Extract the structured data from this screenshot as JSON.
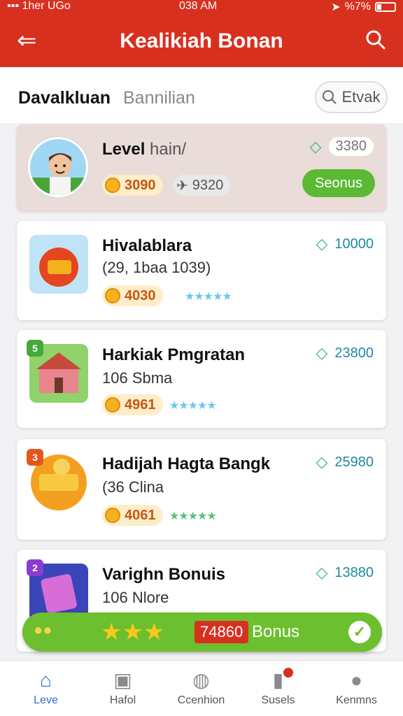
{
  "status": {
    "left": "▪▪▪ 1her  UGo",
    "time": "038 AM",
    "battery": "%7%"
  },
  "header": {
    "title": "Kealikiah Bonan"
  },
  "section": {
    "title": "Davalkluan",
    "subtitle": "Bannilian",
    "filter_label": "Etvak"
  },
  "level_card": {
    "title": "Level",
    "title_muted": "hain/",
    "tag_value": "3380",
    "coins": "3090",
    "secondary": "9320",
    "button_label": "Seonus"
  },
  "items": [
    {
      "title": "Hivalablara",
      "subtitle": "(29, 1baa 1039)",
      "coins": "4030",
      "stars": "★★★★★",
      "value": "10000",
      "badge": ""
    },
    {
      "title": "Harkiak Pmgratan",
      "subtitle": "106 Sbma",
      "coins": "4961",
      "stars": "★★★★★",
      "value": "23800",
      "badge": "5"
    },
    {
      "title": "Hadijah Hagta Bangk",
      "subtitle": "(36 Clina",
      "coins": "4061",
      "stars": "★★★★★",
      "value": "25980",
      "badge": "3"
    },
    {
      "title": "Varighn Bonuis",
      "subtitle": "106 Nlore",
      "coins": "",
      "stars": "",
      "value": "13880",
      "badge": "2"
    }
  ],
  "bonus_bar": {
    "value": "74860",
    "label": "Bonus"
  },
  "tabs": [
    {
      "label": "Leve",
      "icon": "home-icon"
    },
    {
      "label": "Hafol",
      "icon": "box-icon"
    },
    {
      "label": "Ccenhion",
      "icon": "chat-icon"
    },
    {
      "label": "Susels",
      "icon": "bell-icon"
    },
    {
      "label": "Kenmns",
      "icon": "user-icon"
    }
  ],
  "colors": {
    "brand": "#d8301f",
    "accent": "#6cbf2f",
    "tab_active": "#2f6fd6"
  }
}
